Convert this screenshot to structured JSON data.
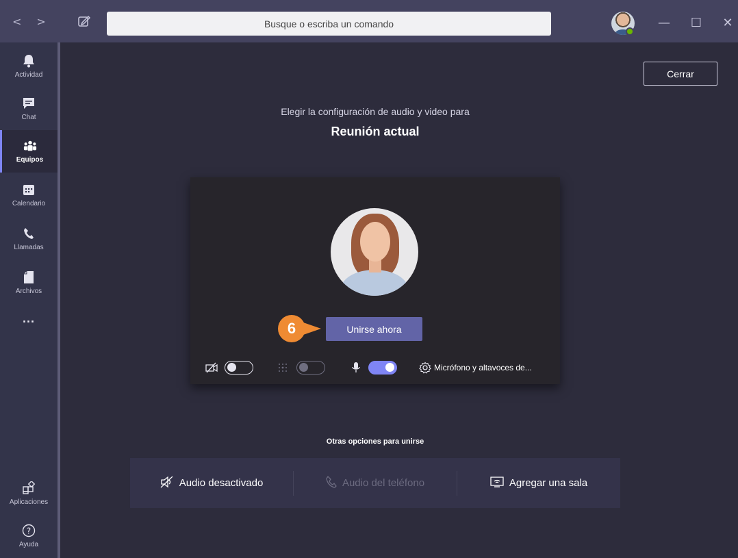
{
  "titlebar": {
    "back_glyph": "<",
    "forward_glyph": ">",
    "search_placeholder": "Busque o escriba un comando",
    "minimize_glyph": "—",
    "maximize_glyph": "☐",
    "close_glyph": "✕"
  },
  "sidebar": {
    "items": [
      {
        "label": "Actividad",
        "icon": "bell-icon"
      },
      {
        "label": "Chat",
        "icon": "chat-icon"
      },
      {
        "label": "Equipos",
        "icon": "teams-icon",
        "active": true
      },
      {
        "label": "Calendario",
        "icon": "calendar-icon"
      },
      {
        "label": "Llamadas",
        "icon": "phone-icon"
      },
      {
        "label": "Archivos",
        "icon": "file-icon"
      }
    ],
    "more_glyph": "···",
    "apps_label": "Aplicaciones",
    "help_label": "Ayuda"
  },
  "main": {
    "close_label": "Cerrar",
    "subtitle": "Elegir la configuración de audio y video para",
    "meeting_title": "Reunión actual",
    "join_label": "Unirse ahora",
    "callout_number": "6",
    "device_label": "Micrófono y altavoces de...",
    "video_on": false,
    "blur_on": false,
    "mic_on": true,
    "other_options_title": "Otras opciones para unirse",
    "options": [
      {
        "label": "Audio desactivado",
        "icon": "speaker-off-icon",
        "enabled": true
      },
      {
        "label": "Audio del teléfono",
        "icon": "phone-icon",
        "enabled": false
      },
      {
        "label": "Agregar una sala",
        "icon": "cast-icon",
        "enabled": true
      }
    ]
  },
  "colors": {
    "accent": "#6264a7",
    "toggle_on": "#7f85f5",
    "callout": "#ef8b33",
    "presence": "#6bb700"
  }
}
